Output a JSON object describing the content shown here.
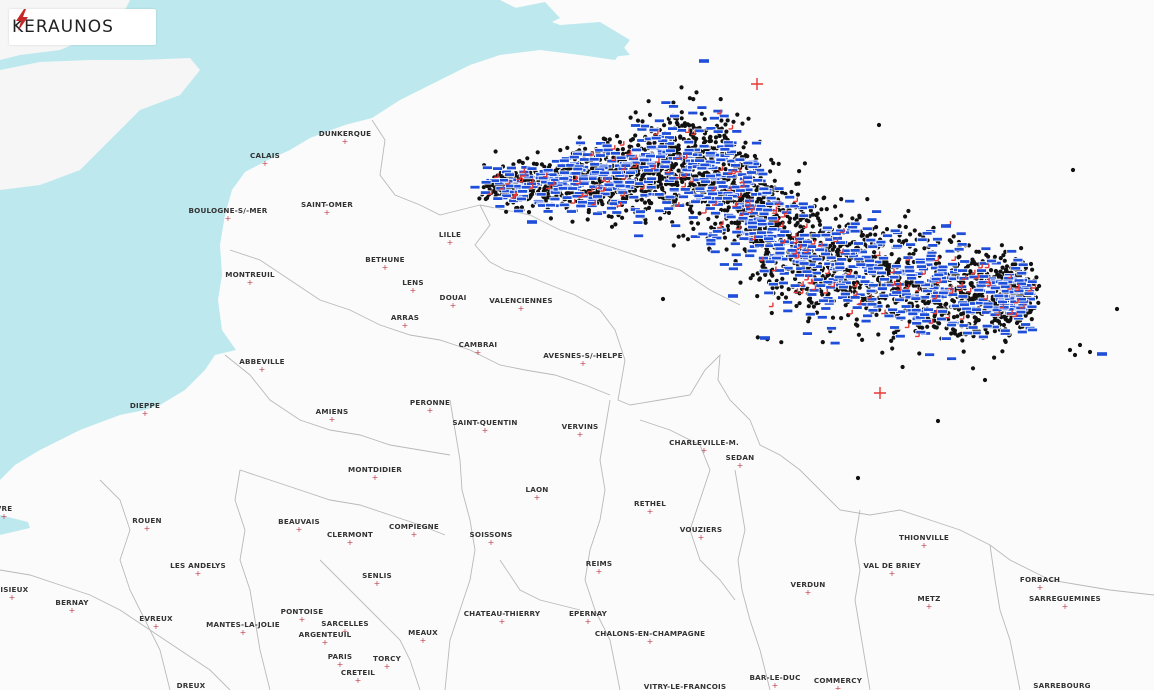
{
  "brand": {
    "logo_text": "KERAUNOS",
    "logo_icon": "lightning-bolt-icon",
    "accent": "#c62828"
  },
  "colors": {
    "sea": "#bde9ee",
    "land": "#fbfbfb",
    "borders": "#b9b9b9",
    "strike_cg": "#111111",
    "strike_negative": "#1f4fd8",
    "strike_positive": "#e53935",
    "city_marker": "#c0404a"
  },
  "cities": [
    {
      "name": "DUNKERQUE"
    },
    {
      "name": "CALAIS"
    },
    {
      "name": "BOULOGNE-S/-MER"
    },
    {
      "name": "SAINT-OMER"
    },
    {
      "name": "LILLE"
    },
    {
      "name": "BETHUNE"
    },
    {
      "name": "LENS"
    },
    {
      "name": "DOUAI"
    },
    {
      "name": "VALENCIENNES"
    },
    {
      "name": "ARRAS"
    },
    {
      "name": "MONTREUIL"
    },
    {
      "name": "CAMBRAI"
    },
    {
      "name": "AVESNES-S/-HELPE"
    },
    {
      "name": "ABBEVILLE"
    },
    {
      "name": "DIEPPE"
    },
    {
      "name": "AMIENS"
    },
    {
      "name": "PERONNE"
    },
    {
      "name": "SAINT-QUENTIN"
    },
    {
      "name": "VERVINS"
    },
    {
      "name": "CHARLEVILLE-M."
    },
    {
      "name": "SEDAN"
    },
    {
      "name": "MONTDIDIER"
    },
    {
      "name": "LAON"
    },
    {
      "name": "RETHEL"
    },
    {
      "name": "ROUEN"
    },
    {
      "name": "BEAUVAIS"
    },
    {
      "name": "CLERMONT"
    },
    {
      "name": "COMPIEGNE"
    },
    {
      "name": "SOISSONS"
    },
    {
      "name": "VOUZIERS"
    },
    {
      "name": "THIONVILLE"
    },
    {
      "name": "LES ANDELYS"
    },
    {
      "name": "SENLIS"
    },
    {
      "name": "REIMS"
    },
    {
      "name": "VERDUN"
    },
    {
      "name": "VAL DE BRIEY"
    },
    {
      "name": "FORBACH"
    },
    {
      "name": "SARREGUEMINES"
    },
    {
      "name": "METZ"
    },
    {
      "name": "LISIEUX"
    },
    {
      "name": "BERNAY"
    },
    {
      "name": "EVREUX"
    },
    {
      "name": "MANTES-LA-JOLIE"
    },
    {
      "name": "PONTOISE"
    },
    {
      "name": "SARCELLES"
    },
    {
      "name": "ARGENTEUIL"
    },
    {
      "name": "MEAUX"
    },
    {
      "name": "CHATEAU-THIERRY"
    },
    {
      "name": "EPERNAY"
    },
    {
      "name": "CHALONS-EN-CHAMPAGNE"
    },
    {
      "name": "PARIS"
    },
    {
      "name": "TORCY"
    },
    {
      "name": "CRETEIL"
    },
    {
      "name": "BAR-LE-DUC"
    },
    {
      "name": "COMMERCY"
    },
    {
      "name": "DREUX"
    },
    {
      "name": "SARREBOURG"
    },
    {
      "name": "VITRY-LE-FRANCOIS"
    },
    {
      "name": "VRE"
    }
  ]
}
